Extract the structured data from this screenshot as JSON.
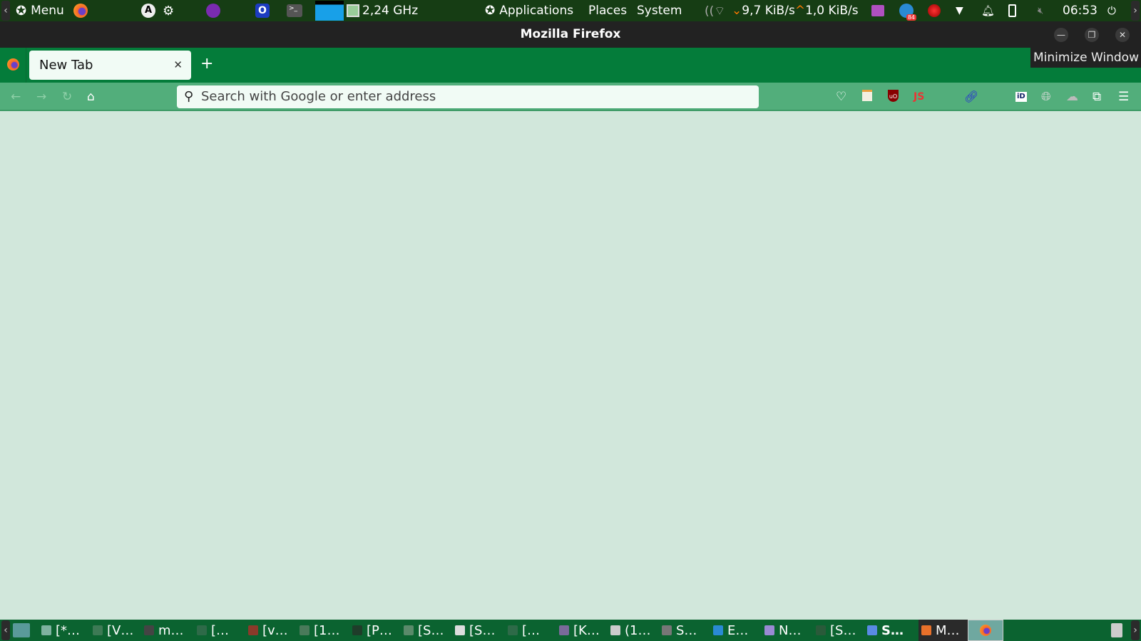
{
  "top_panel": {
    "menu_label": "Menu",
    "cpu_freq": "2,24 GHz",
    "applications": "Applications",
    "places": "Places",
    "system": "System",
    "net_down": "9,7 KiB/s",
    "net_up": "1,0 KiB/s",
    "clock": "06:53",
    "notification_badge": "84"
  },
  "window": {
    "title": "Mozilla Firefox",
    "tooltip": "Minimize Window"
  },
  "browser": {
    "tab_title": "New Tab",
    "url_placeholder": "Search with Google or enter address"
  },
  "taskbar": {
    "items": [
      {
        "label": "[*…",
        "color": "#7fb2a0"
      },
      {
        "label": "[V…",
        "color": "#3d7a55"
      },
      {
        "label": "m…",
        "color": "#444"
      },
      {
        "label": "[…",
        "color": "#2e6a48"
      },
      {
        "label": "[v…",
        "color": "#8b3a2a"
      },
      {
        "label": "[1…",
        "color": "#4a7a5a"
      },
      {
        "label": "[P…",
        "color": "#1f3d2a"
      },
      {
        "label": "[S…",
        "color": "#5a8a6a"
      },
      {
        "label": "[S…",
        "color": "#ddd"
      },
      {
        "label": "[…",
        "color": "#2e6a48"
      },
      {
        "label": "[K…",
        "color": "#7a6a9a"
      },
      {
        "label": "(1…",
        "color": "#ccc"
      },
      {
        "label": "S…",
        "color": "#777"
      },
      {
        "label": "E…",
        "color": "#2a8ad4"
      },
      {
        "label": "N…",
        "color": "#9a8ad4"
      },
      {
        "label": "[S…",
        "color": "#2a5a3a"
      },
      {
        "label": "S…",
        "color": "#5a8ae4"
      },
      {
        "label": "M…",
        "color": "#e8702a"
      }
    ]
  }
}
